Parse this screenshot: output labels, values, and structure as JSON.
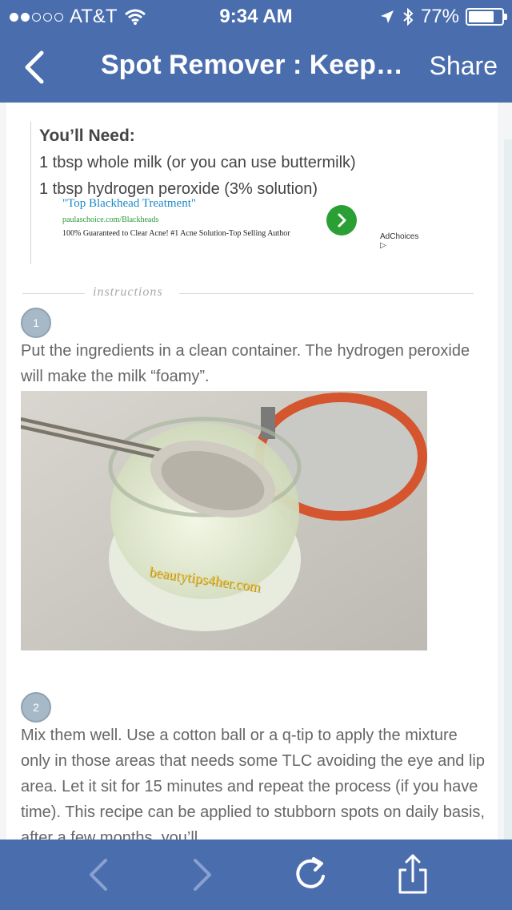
{
  "status": {
    "carrier": "AT&T",
    "time": "9:34 AM",
    "battery": "77%",
    "battery_level": 0.77,
    "signal_bars_full": 2,
    "signal_bars_total": 5
  },
  "nav": {
    "title": "Spot Remover : Keep…",
    "share_label": "Share",
    "back_icon": "chevron-left-icon"
  },
  "need": {
    "title": "You’ll Need:",
    "items": [
      "1 tbsp whole milk (or you can use buttermilk)",
      "1 tbsp hydrogen peroxide (3% solution)"
    ]
  },
  "ad": {
    "title": "\"Top Blackhead Treatment\"",
    "url": "paulaschoice.com/Blackheads",
    "description": "100% Guaranteed to Clear Acne! #1 Acne Solution-Top Selling Author",
    "adchoices": "AdChoices ▷"
  },
  "section_label": "instructions",
  "steps": [
    {
      "number": "1",
      "text": "Put the ingredients in a clean container. The hydrogen peroxide will make the milk “foamy”."
    },
    {
      "number": "2",
      "text": "Mix them well. Use a cotton ball or a q-tip to apply the mixture only in those areas that needs some TLC avoiding the eye and lip area. Let it sit for 15 minutes and repeat the process (if you have time). This recipe can be applied to stubborn spots on daily basis, after a few months, you’ll"
    }
  ],
  "photo": {
    "watermark": "beautytips4her.com"
  },
  "toolbar": {
    "back_icon": "chevron-left-icon",
    "forward_icon": "chevron-right-icon",
    "reload_icon": "reload-icon",
    "share_icon": "share-icon"
  },
  "colors": {
    "brand": "#4a6dae",
    "badge": "#a7b9c6",
    "ad_link": "#1b88c9",
    "ad_go": "#2a9f34"
  }
}
